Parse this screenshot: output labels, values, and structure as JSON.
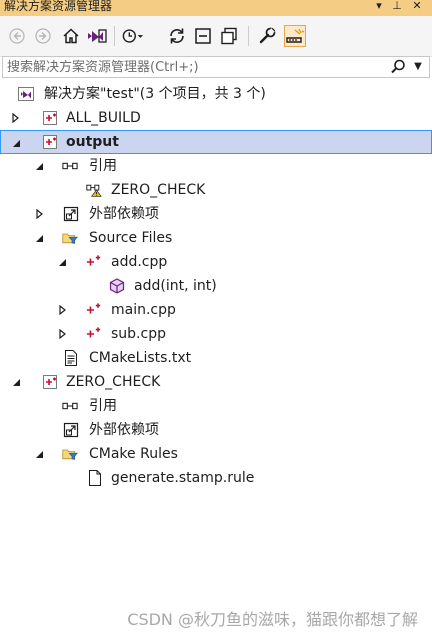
{
  "window": {
    "title": "解决方案资源管理器",
    "pin_glyph": "▾",
    "pin2_glyph": "⊥",
    "close_glyph": "✕"
  },
  "toolbar": {
    "items": [
      "back-icon",
      "forward-icon",
      "home-icon",
      "switch-views-icon",
      "pending-changes-filter-icon",
      "sync-icon",
      "collapse-all-icon",
      "show-all-files-icon",
      "properties-icon",
      "preview-selected-icon"
    ]
  },
  "search": {
    "placeholder": "搜索解决方案资源管理器(Ctrl+;)",
    "value": ""
  },
  "tree": [
    {
      "id": "solution",
      "label": "解决方案\"test\"(3 个项目，共 3 个)",
      "icon": "solution-icon",
      "expander": "",
      "bold": false,
      "selected": false
    },
    {
      "id": "all-build",
      "label": "ALL_BUILD",
      "icon": "cmake-project-icon",
      "expander": "collapsed",
      "bold": false,
      "selected": false
    },
    {
      "id": "output",
      "label": "output",
      "icon": "cmake-project-icon",
      "expander": "expanded",
      "bold": true,
      "selected": true
    },
    {
      "id": "output-refs",
      "label": "引用",
      "icon": "references-icon",
      "expander": "expanded",
      "bold": false,
      "selected": false
    },
    {
      "id": "zero-check-ref",
      "label": "ZERO_CHECK",
      "icon": "reference-warning-icon",
      "expander": "",
      "bold": false,
      "selected": false
    },
    {
      "id": "output-external",
      "label": "外部依赖项",
      "icon": "external-dependencies-icon",
      "expander": "collapsed",
      "bold": false,
      "selected": false
    },
    {
      "id": "source-files",
      "label": "Source Files",
      "icon": "filter-folder-icon",
      "expander": "expanded",
      "bold": false,
      "selected": false
    },
    {
      "id": "add-cpp",
      "label": "add.cpp",
      "icon": "cpp-file-icon",
      "expander": "expanded",
      "bold": false,
      "selected": false
    },
    {
      "id": "add-func",
      "label": "add(int, int)",
      "icon": "method-icon",
      "expander": "",
      "bold": false,
      "selected": false
    },
    {
      "id": "main-cpp",
      "label": "main.cpp",
      "icon": "cpp-file-icon",
      "expander": "collapsed",
      "bold": false,
      "selected": false
    },
    {
      "id": "sub-cpp",
      "label": "sub.cpp",
      "icon": "cpp-file-icon",
      "expander": "collapsed",
      "bold": false,
      "selected": false
    },
    {
      "id": "cmakelists",
      "label": "CMakeLists.txt",
      "icon": "text-file-icon",
      "expander": "",
      "bold": false,
      "selected": false
    },
    {
      "id": "zero-check",
      "label": "ZERO_CHECK",
      "icon": "cmake-project-icon",
      "expander": "expanded",
      "bold": false,
      "selected": false
    },
    {
      "id": "zc-refs",
      "label": "引用",
      "icon": "references-icon",
      "expander": "",
      "bold": false,
      "selected": false
    },
    {
      "id": "zc-external",
      "label": "外部依赖项",
      "icon": "external-dependencies-icon",
      "expander": "",
      "bold": false,
      "selected": false
    },
    {
      "id": "cmake-rules",
      "label": "CMake Rules",
      "icon": "filter-folder-icon",
      "expander": "expanded",
      "bold": false,
      "selected": false
    },
    {
      "id": "stamp-rule",
      "label": "generate.stamp.rule",
      "icon": "file-icon",
      "expander": "",
      "bold": false,
      "selected": false
    }
  ],
  "watermark": "CSDN @秋刀鱼的滋味，猫跟你都想了解",
  "colors": {
    "title_bar": "#f5cc84",
    "selection": "#ccd5f0",
    "selection_border": "#3399ff",
    "cpp_red": "#c8102e",
    "vs_purple": "#68217a"
  }
}
